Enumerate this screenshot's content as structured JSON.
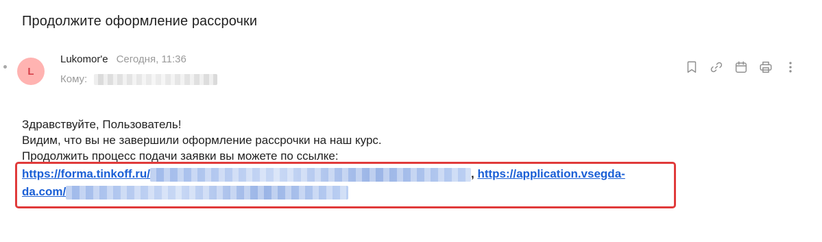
{
  "email": {
    "subject": "Продолжите оформление рассрочки",
    "sender": {
      "name": "Lukomor'e",
      "time": "Сегодня, 11:36",
      "avatar_letter": "L"
    },
    "to_label": "Кому:",
    "toolbar": {
      "icons": [
        "bookmark-icon",
        "link-icon",
        "calendar-icon",
        "print-icon",
        "more-vertical-icon"
      ]
    },
    "body": {
      "greeting": "Здравствуйте, Пользователь!",
      "line1": "Видим, что вы не завершили оформление рассрочки на наш курс.",
      "line2": "Продолжить процесс подачи заявки вы можете по ссылке:"
    },
    "links": {
      "link1_visible": "https://forma.tinkoff.ru/",
      "separator": ",",
      "link2_visible_part1": "https://application.vsegda-",
      "link2_visible_part2": "da.com/"
    }
  },
  "colors": {
    "link": "#1a5fd6",
    "avatar_bg": "#ffb3b1",
    "avatar_text": "#d6404a",
    "highlight": "#e03a3a",
    "muted": "#9a9a9a"
  }
}
